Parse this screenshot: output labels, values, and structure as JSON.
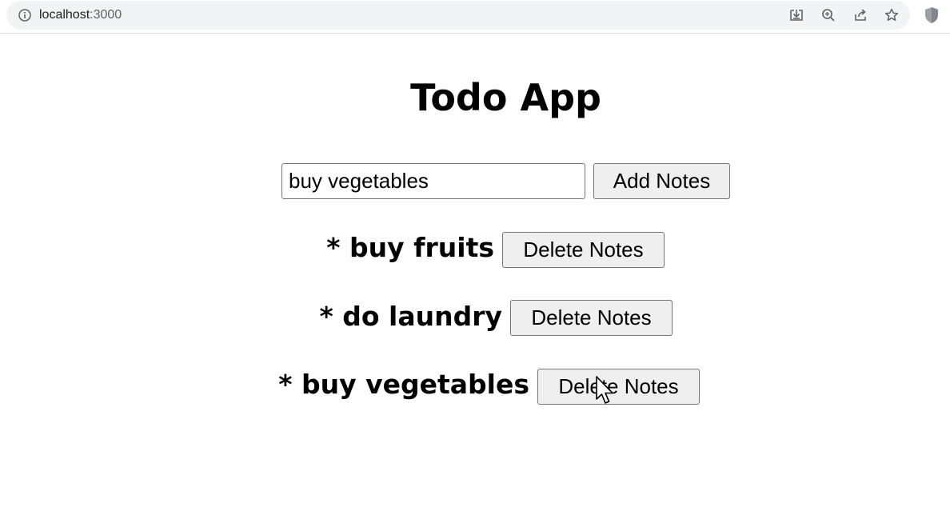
{
  "browser": {
    "url_host": "localhost",
    "url_port": ":3000",
    "icons": [
      "info-icon",
      "install-app-icon",
      "zoom-icon",
      "share-icon",
      "bookmark-star-icon",
      "extension-shield-icon"
    ]
  },
  "app": {
    "title": "Todo App",
    "input_value": "buy vegetables",
    "add_button_label": "Add Notes",
    "delete_button_label": "Delete Notes",
    "todos": [
      {
        "text": "* buy fruits"
      },
      {
        "text": "* do laundry"
      },
      {
        "text": "* buy vegetables"
      }
    ]
  },
  "colors": {
    "button_bg": "#efefef",
    "button_border": "#767676",
    "omnibox_bg": "#f1f3f4"
  }
}
